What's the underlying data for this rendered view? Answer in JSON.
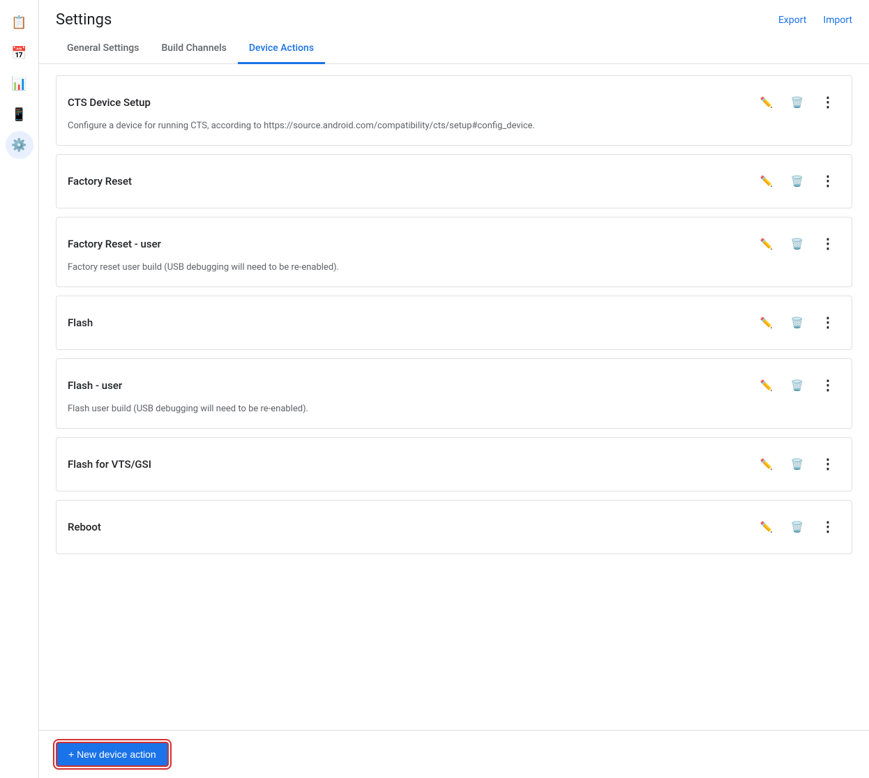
{
  "header": {
    "title": "Settings",
    "export_label": "Export",
    "import_label": "Import"
  },
  "tabs": [
    {
      "id": "general",
      "label": "General Settings",
      "active": false
    },
    {
      "id": "build-channels",
      "label": "Build Channels",
      "active": false
    },
    {
      "id": "device-actions",
      "label": "Device Actions",
      "active": true
    }
  ],
  "actions": [
    {
      "id": "cts-device-setup",
      "title": "CTS Device Setup",
      "description": "Configure a device for running CTS, according to https://source.android.com/compatibility/cts/setup#config_device."
    },
    {
      "id": "factory-reset",
      "title": "Factory Reset",
      "description": ""
    },
    {
      "id": "factory-reset-user",
      "title": "Factory Reset - user",
      "description": "Factory reset user build (USB debugging will need to be re-enabled)."
    },
    {
      "id": "flash",
      "title": "Flash",
      "description": ""
    },
    {
      "id": "flash-user",
      "title": "Flash - user",
      "description": "Flash user build (USB debugging will need to be re-enabled)."
    },
    {
      "id": "flash-vts-gsi",
      "title": "Flash for VTS/GSI",
      "description": ""
    },
    {
      "id": "reboot",
      "title": "Reboot",
      "description": ""
    }
  ],
  "bottom": {
    "new_action_label": "+ New device action"
  },
  "sidebar": {
    "items": [
      {
        "id": "clipboard",
        "icon": "📋"
      },
      {
        "id": "calendar",
        "icon": "📅"
      },
      {
        "id": "chart",
        "icon": "📊"
      },
      {
        "id": "phone",
        "icon": "📱"
      },
      {
        "id": "settings",
        "icon": "⚙️",
        "active": true
      }
    ]
  }
}
